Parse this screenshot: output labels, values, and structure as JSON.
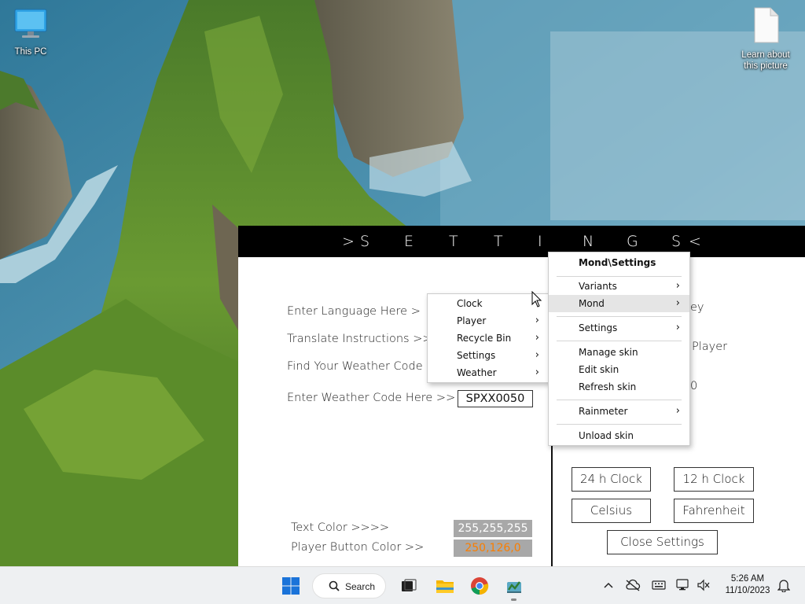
{
  "desktop": {
    "icons": [
      {
        "label": "This PC"
      },
      {
        "label": "Learn about this picture"
      }
    ]
  },
  "skin": {
    "title_letters": [
      ">",
      "S",
      "E",
      "T",
      "T",
      "I",
      "N",
      "G",
      "S",
      "<"
    ],
    "left": {
      "language": "Enter Language Here      >",
      "translate": "Translate Instructions     >>",
      "weather_find": "Find Your Weather Code H",
      "weather_enter": "Enter Weather Code Here >>",
      "weather_code": "SPXX0050",
      "text_color_label": "Text Color    >>>>",
      "text_color_value": "255,255,255",
      "player_color_label": "Player Button Color    >>",
      "player_color_value": "250,126,0",
      "player_color_hex": "#fa7e00"
    },
    "right_partial": {
      "key": "ey",
      "player": "Player",
      "zero": "0"
    },
    "buttons": {
      "clock24": "24 h Clock",
      "clock12": "12 h Clock",
      "celsius": "Celsius",
      "fahrenheit": "Fahrenheit",
      "close": "Close Settings"
    }
  },
  "submenu": {
    "items": [
      {
        "label": "Clock",
        "arrow": ""
      },
      {
        "label": "Player",
        "arrow": "›"
      },
      {
        "label": "Recycle Bin",
        "arrow": "›"
      },
      {
        "label": "Settings",
        "arrow": "›"
      },
      {
        "label": "Weather",
        "arrow": "›"
      }
    ]
  },
  "mainmenu": {
    "title": "Mond\\Settings",
    "variants": "Variants",
    "mond": "Mond",
    "settings": "Settings",
    "manage": "Manage skin",
    "edit": "Edit skin",
    "refresh": "Refresh skin",
    "rainmeter": "Rainmeter",
    "unload": "Unload skin",
    "arrow": "›"
  },
  "taskbar": {
    "search_label": "Search",
    "time": "5:26 AM",
    "date": "11/10/2023"
  }
}
